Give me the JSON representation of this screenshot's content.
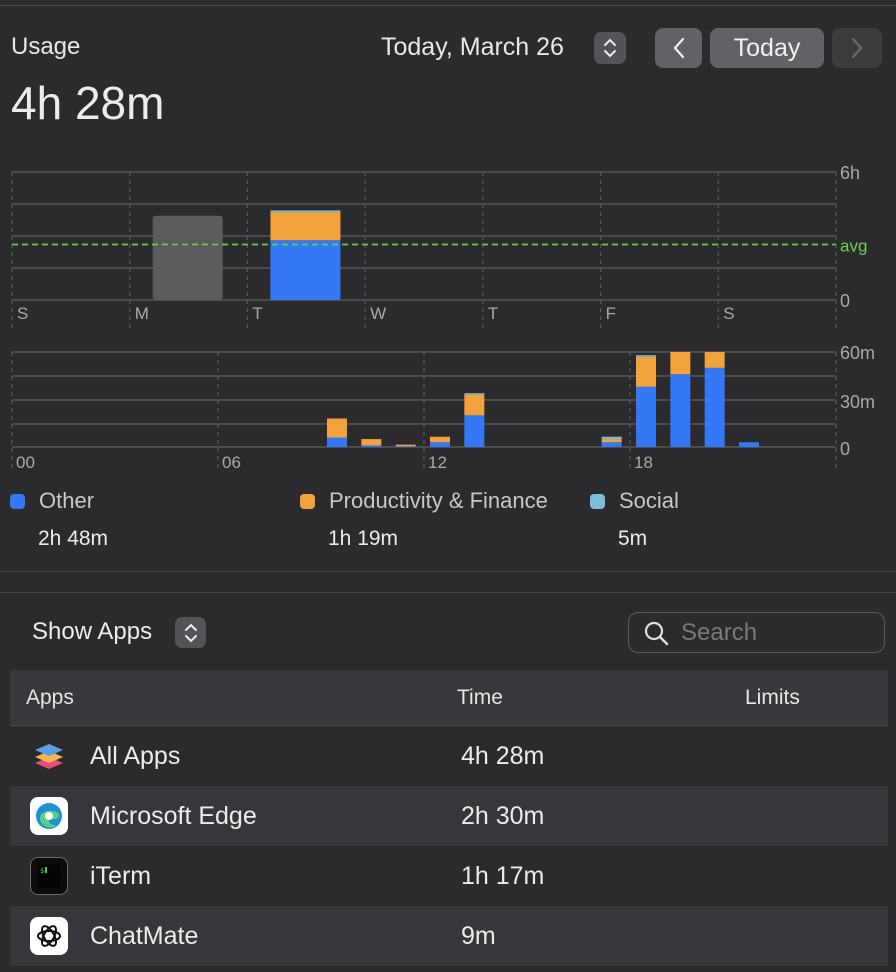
{
  "header": {
    "title": "Usage",
    "total": "4h 28m",
    "date": "Today, March 26",
    "today_button": "Today"
  },
  "weekly_chart": {
    "type": "bar",
    "categories": [
      "S",
      "M",
      "T",
      "W",
      "T",
      "F",
      "S"
    ],
    "y_ticks": [
      "6h",
      "avg",
      "0"
    ],
    "ylim_hours": [
      0,
      6
    ],
    "avg_hours": 2.6,
    "series": [
      {
        "name": "Other",
        "color": "#3478f6",
        "values": [
          0,
          0,
          2.8,
          0,
          0,
          0,
          0
        ]
      },
      {
        "name": "Productivity & Finance",
        "color": "#f2a23a",
        "values": [
          0,
          0,
          1.32,
          0,
          0,
          0,
          0
        ]
      },
      {
        "name": "Social",
        "color": "#7dbcd6",
        "values": [
          0,
          0,
          0.08,
          0,
          0,
          0,
          0
        ]
      }
    ],
    "previous_total_hours": [
      0,
      3.95,
      0,
      0,
      0,
      0,
      0
    ]
  },
  "chart_data": {
    "type": "bar",
    "title": "",
    "x_tick_labels": [
      "00",
      "06",
      "12",
      "18"
    ],
    "y_ticks": [
      "60m",
      "30m",
      "0"
    ],
    "ylim": [
      0,
      60
    ],
    "hours": [
      9,
      10,
      11,
      12,
      13,
      17,
      18,
      19,
      20,
      21
    ],
    "series": [
      {
        "name": "Other",
        "color": "#3478f6",
        "values": [
          6,
          1,
          0.5,
          3,
          20,
          3,
          38,
          46,
          50,
          3
        ]
      },
      {
        "name": "Productivity & Finance",
        "color": "#f2a23a",
        "values": [
          12,
          4,
          1,
          3.5,
          13,
          2,
          19,
          14,
          10,
          0
        ]
      },
      {
        "name": "Social",
        "color": "#7dbcd6",
        "values": [
          0,
          0,
          0,
          0,
          1,
          1.5,
          1,
          0,
          0,
          0
        ]
      }
    ]
  },
  "legend": [
    {
      "label": "Other",
      "value": "2h 48m",
      "color": "#3478f6"
    },
    {
      "label": "Productivity & Finance",
      "value": "1h 19m",
      "color": "#f2a23a"
    },
    {
      "label": "Social",
      "value": "5m",
      "color": "#7dbcd6"
    }
  ],
  "apps_section": {
    "show_label": "Show Apps",
    "search_placeholder": "Search",
    "columns": [
      "Apps",
      "Time",
      "Limits"
    ],
    "rows": [
      {
        "name": "All Apps",
        "time": "4h 28m",
        "icon": "stack-icon"
      },
      {
        "name": "Microsoft Edge",
        "time": "2h 30m",
        "icon": "edge-icon"
      },
      {
        "name": "iTerm",
        "time": "1h 17m",
        "icon": "terminal-icon"
      },
      {
        "name": "ChatMate",
        "time": "9m",
        "icon": "chatmate-icon"
      }
    ]
  }
}
